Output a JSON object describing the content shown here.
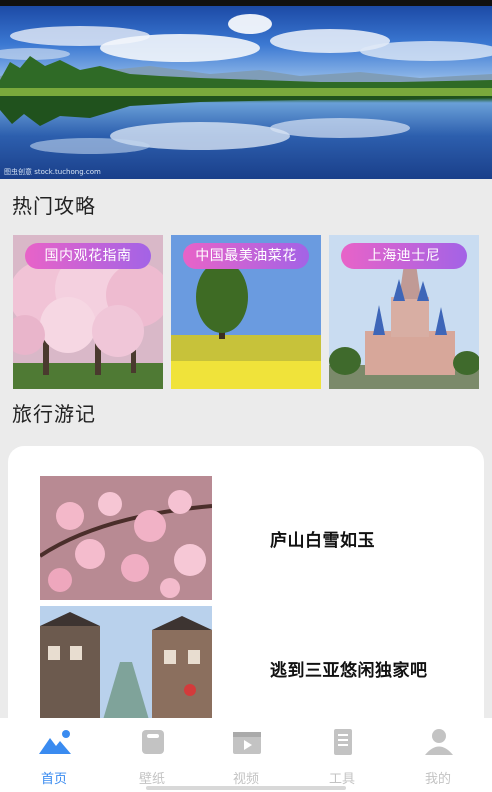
{
  "banner": {
    "caption": "图虫创意 stock.tuchong.com"
  },
  "hot_guides": {
    "title": "热门攻略",
    "items": [
      {
        "label": "国内观花指南"
      },
      {
        "label": "中国最美油菜花"
      },
      {
        "label": "上海迪士尼"
      }
    ]
  },
  "travel_notes": {
    "title": "旅行游记",
    "items": [
      {
        "title": "庐山白雪如玉"
      },
      {
        "title": "逃到三亚悠闲独家吧"
      }
    ]
  },
  "tabbar": {
    "active_color": "#3a8bf0",
    "inactive_color": "#c3c3c3",
    "items": [
      {
        "label": "首页",
        "icon": "mountain-home-icon",
        "active": true
      },
      {
        "label": "壁纸",
        "icon": "wallpaper-icon",
        "active": false
      },
      {
        "label": "视频",
        "icon": "video-icon",
        "active": false
      },
      {
        "label": "工具",
        "icon": "notebook-tool-icon",
        "active": false
      },
      {
        "label": "我的",
        "icon": "user-icon",
        "active": false
      }
    ]
  }
}
